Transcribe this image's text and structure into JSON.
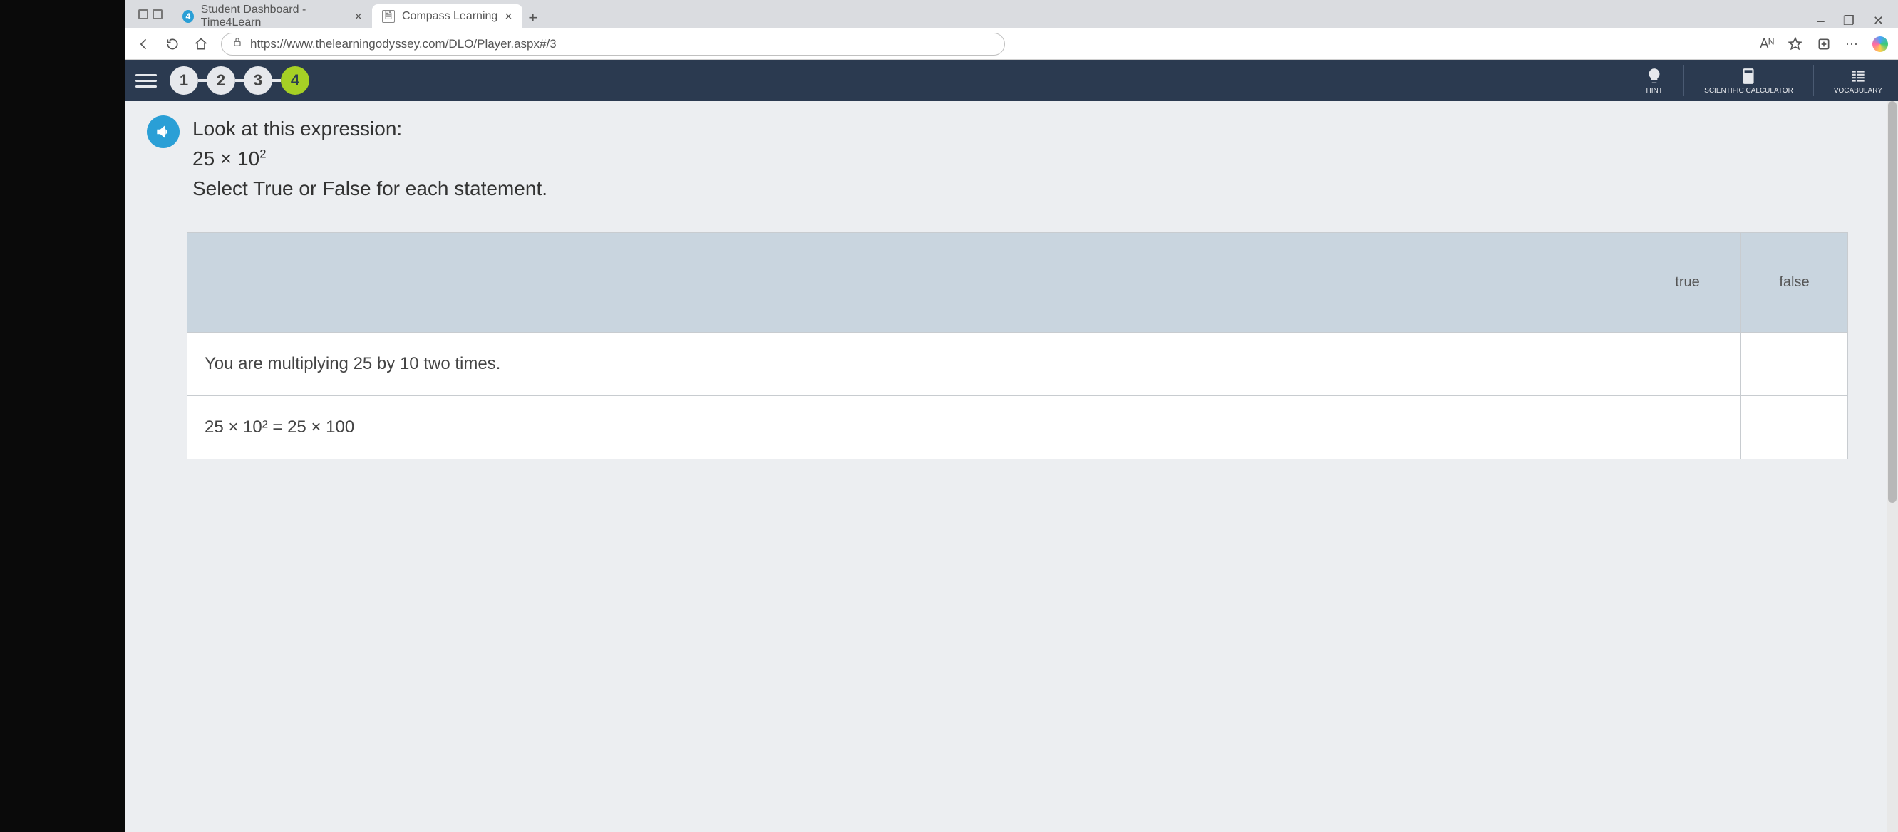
{
  "browser": {
    "tabs": [
      {
        "title": "Student Dashboard - Time4Learn",
        "favicon_text": "4"
      },
      {
        "title": "Compass Learning",
        "favicon_text": ""
      }
    ],
    "url": "https://www.thelearningodyssey.com/DLO/Player.aspx#/3",
    "addr_right_aa": "Aᴺ",
    "window_min": "–",
    "window_max": "❐",
    "window_close": "✕"
  },
  "appbar": {
    "steps": [
      "1",
      "2",
      "3",
      "4"
    ],
    "current_step_index": 3,
    "hint_label": "HINT",
    "calc_label": "SCIENTIFIC CALCULATOR",
    "vocab_label": "VOCABULARY"
  },
  "question": {
    "line1": "Look at this expression:",
    "expr_base": "25 × 10",
    "expr_sup": "2",
    "line3": "Select True or False for each statement."
  },
  "table": {
    "true_label": "true",
    "false_label": "false",
    "rows": [
      {
        "statement": "You are multiplying 25 by 10 two times."
      },
      {
        "statement_html": "25 × 10² = 25 × 100"
      }
    ]
  }
}
